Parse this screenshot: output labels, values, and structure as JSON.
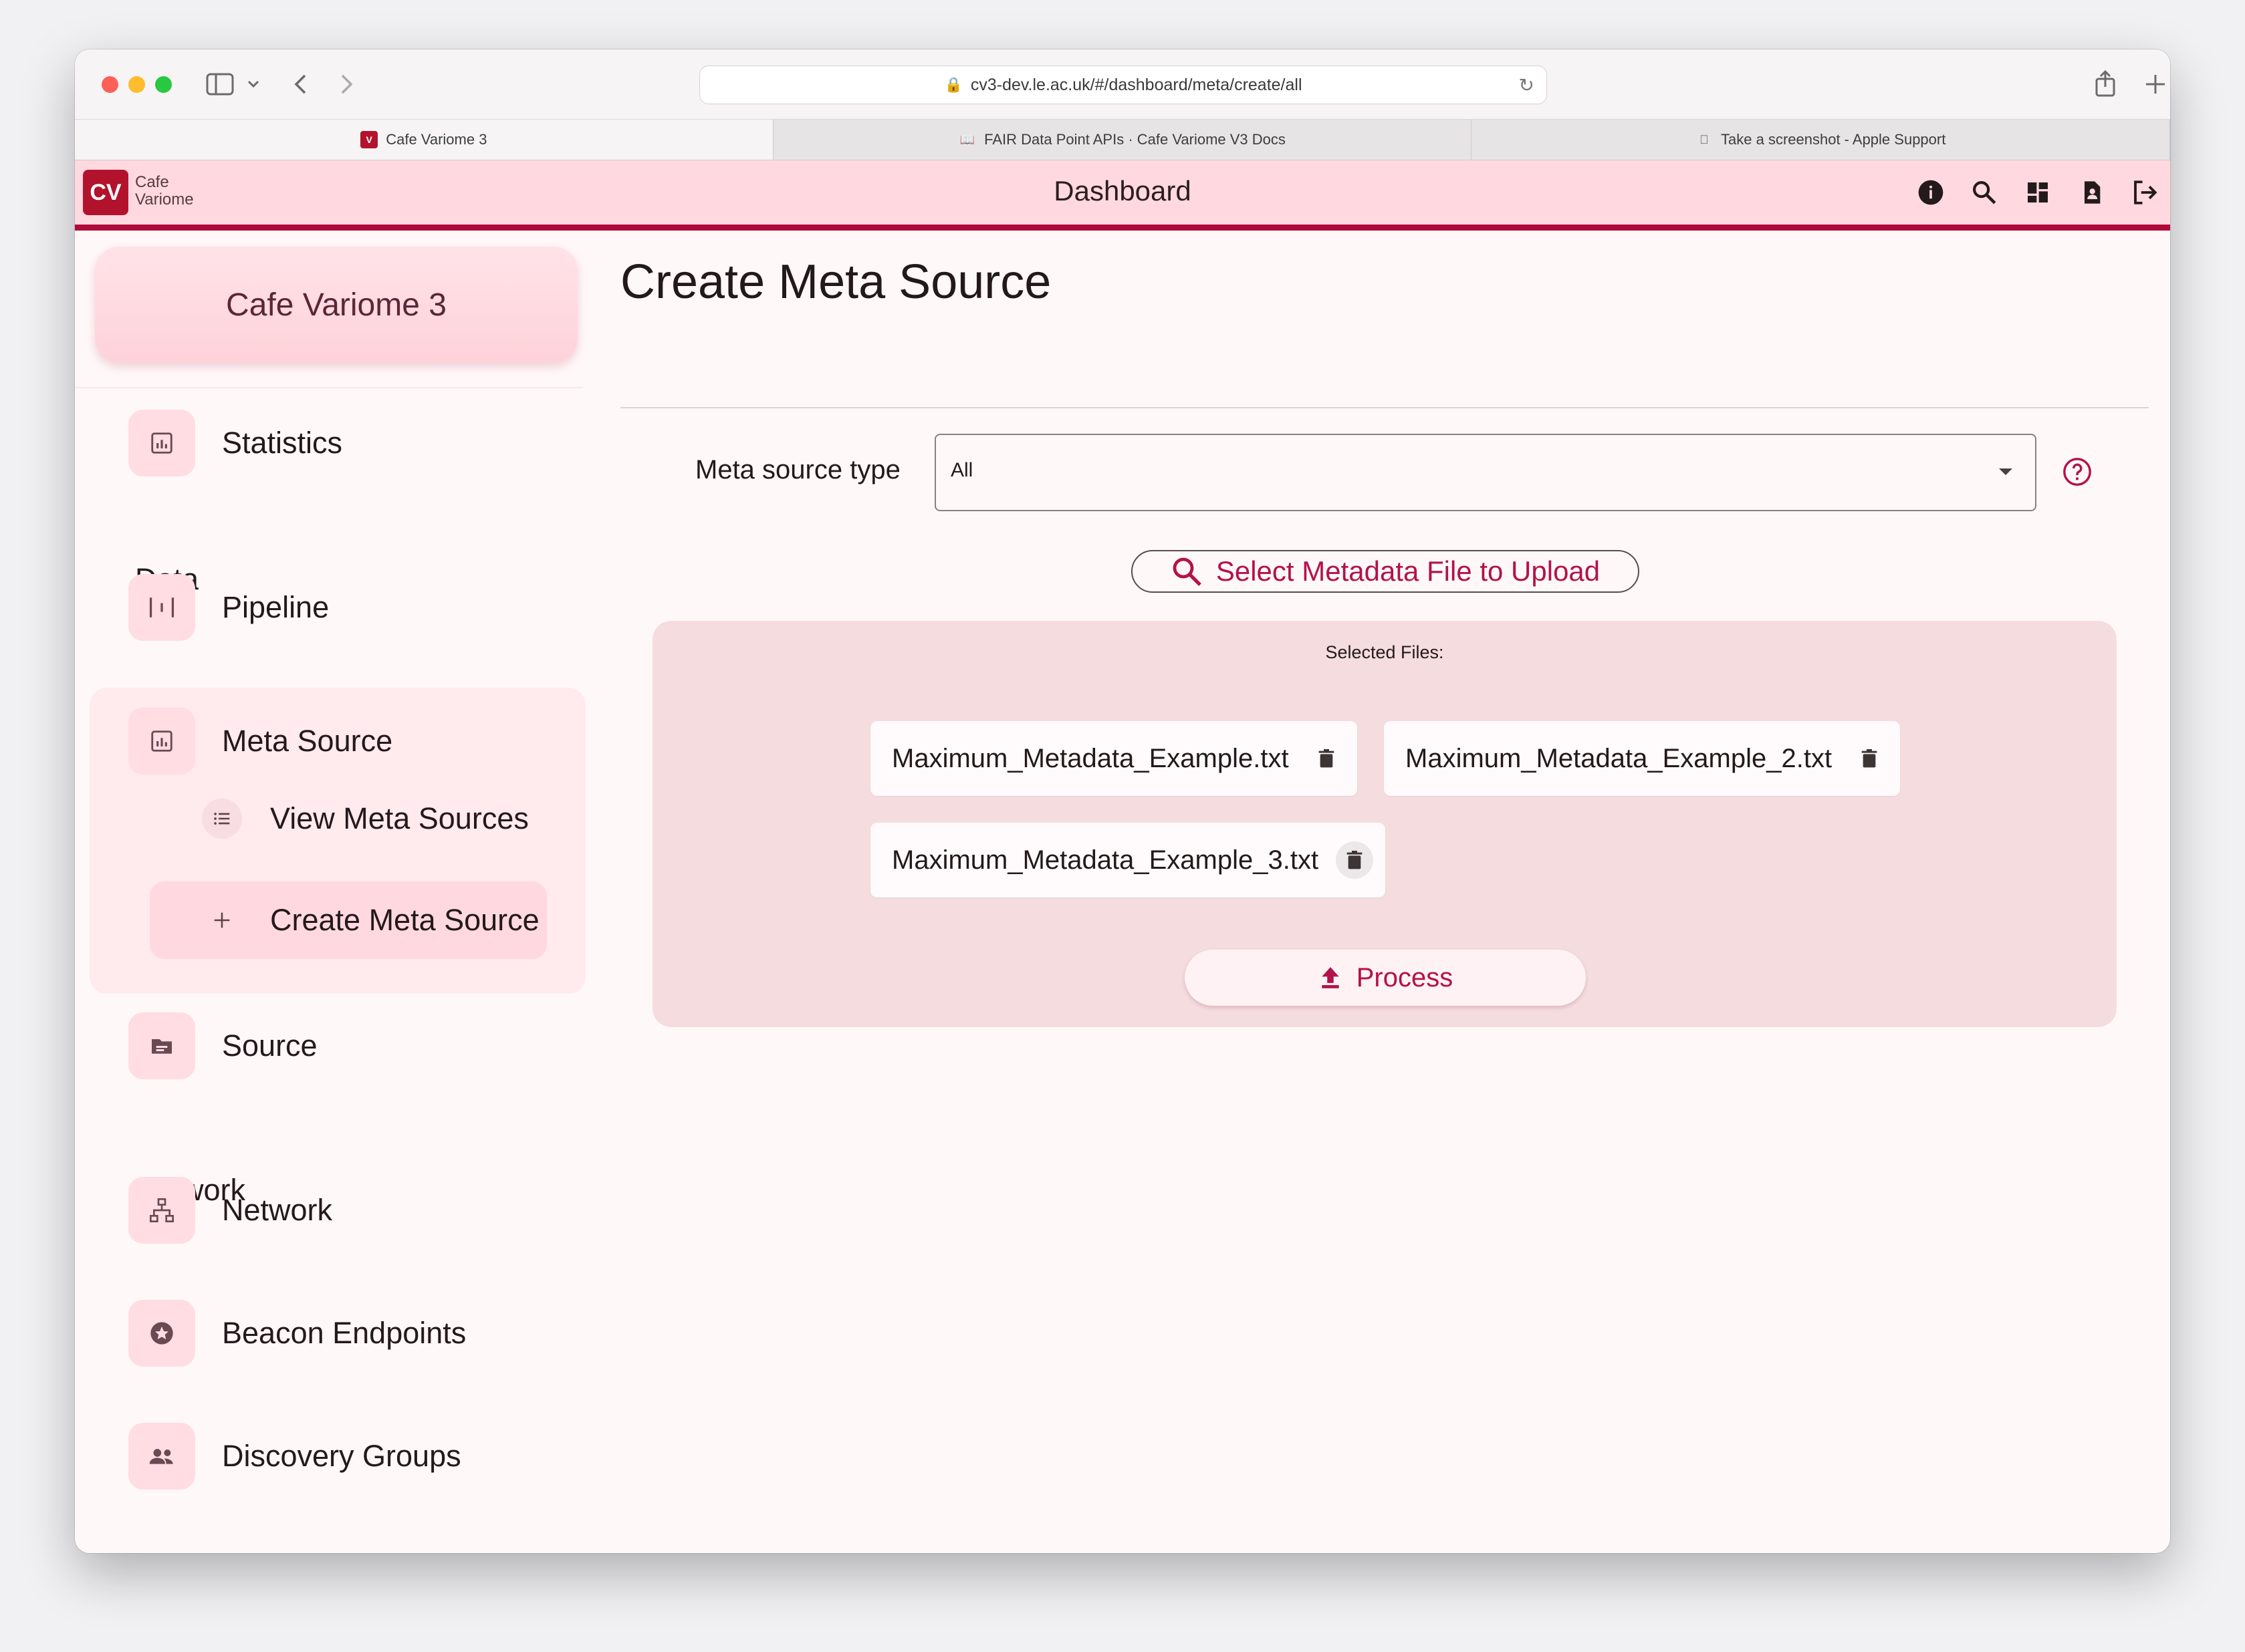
{
  "browser": {
    "url": "cv3-dev.le.ac.uk/#/dashboard/meta/create/all",
    "tabs": [
      {
        "label": "Cafe Variome 3",
        "active": true
      },
      {
        "label": "FAIR Data Point APIs · Cafe Variome V3 Docs",
        "active": false
      },
      {
        "label": "Take a screenshot - Apple Support",
        "active": false
      }
    ]
  },
  "header": {
    "logo_line1": "Cafe",
    "logo_line2": "Variome",
    "logo_mark": "CV",
    "title": "Dashboard",
    "icons": [
      "info-icon",
      "search-icon",
      "dashboard-icon",
      "account-icon",
      "logout-icon"
    ]
  },
  "sidebar": {
    "brand": "Cafe Variome 3",
    "items": {
      "statistics": "Statistics",
      "data_section": "Data",
      "pipeline": "Pipeline",
      "meta_source": "Meta Source",
      "view_meta_sources": "View Meta Sources",
      "create_meta_source": "Create Meta Source",
      "source": "Source",
      "network_section": "Network",
      "network": "Network",
      "beacon_endpoints": "Beacon Endpoints",
      "discovery_groups": "Discovery Groups"
    }
  },
  "main": {
    "title": "Create Meta Source",
    "meta_source_type_label": "Meta source type",
    "meta_source_type_value": "All",
    "upload_button": "Select Metadata File to Upload",
    "selected_files_title": "Selected Files:",
    "files": [
      "Maximum_Metadata_Example.txt",
      "Maximum_Metadata_Example_2.txt",
      "Maximum_Metadata_Example_3.txt"
    ],
    "process_button": "Process"
  },
  "colors": {
    "accent": "#b3124a",
    "header_bg": "#ffd9df",
    "header_border": "#b0093a",
    "panel_bg": "#f5dcdf"
  }
}
